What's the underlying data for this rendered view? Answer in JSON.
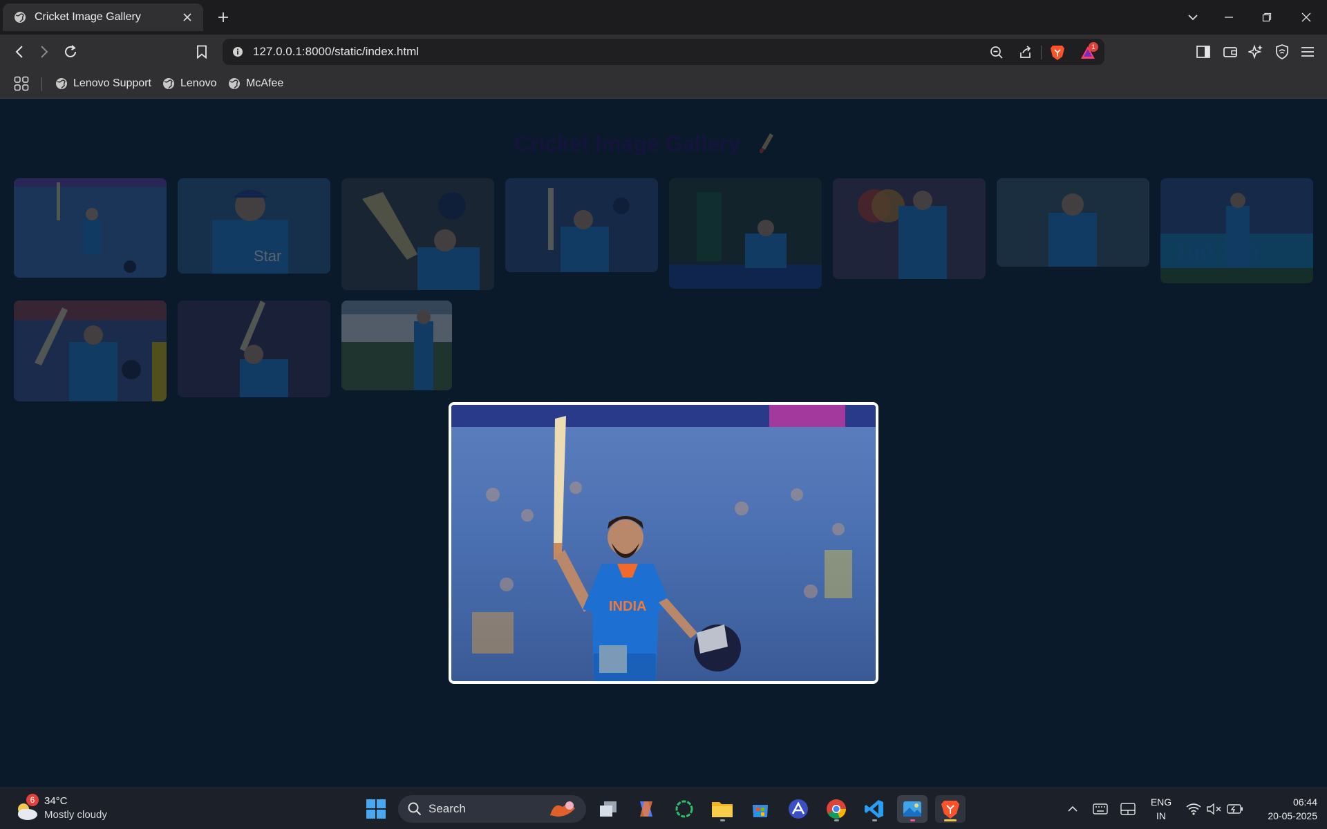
{
  "browser": {
    "tab_title": "Cricket Image Gallery",
    "url": "127.0.0.1:8000/static/index.html",
    "shield_badge": "1",
    "bookmarks": [
      "Lenovo Support",
      "Lenovo",
      "McAfee"
    ]
  },
  "page": {
    "title": "Cricket Image Gallery",
    "thumbnails": [
      {
        "name": "Gallery image 1"
      },
      {
        "name": "Gallery image 2"
      },
      {
        "name": "Gallery image 3"
      },
      {
        "name": "Gallery image 4"
      },
      {
        "name": "Gallery image 5"
      },
      {
        "name": "Gallery image 6"
      },
      {
        "name": "Gallery image 7"
      },
      {
        "name": "Gallery image 8"
      },
      {
        "name": "Gallery image 9"
      },
      {
        "name": "Gallery image 10"
      },
      {
        "name": "Gallery image 11"
      }
    ],
    "lightbox_jersey_text": "INDIA"
  },
  "taskbar": {
    "weather_badge": "6",
    "temperature": "34°C",
    "condition": "Mostly cloudy",
    "search_label": "Search",
    "lang_top": "ENG",
    "lang_bottom": "IN",
    "time": "06:44",
    "date": "20-05-2025"
  },
  "colors": {
    "page_background": "#0b1a2b",
    "title": "#14143c",
    "lightbox_border": "#ffffff",
    "jersey_blue": "#1d6fd1"
  }
}
